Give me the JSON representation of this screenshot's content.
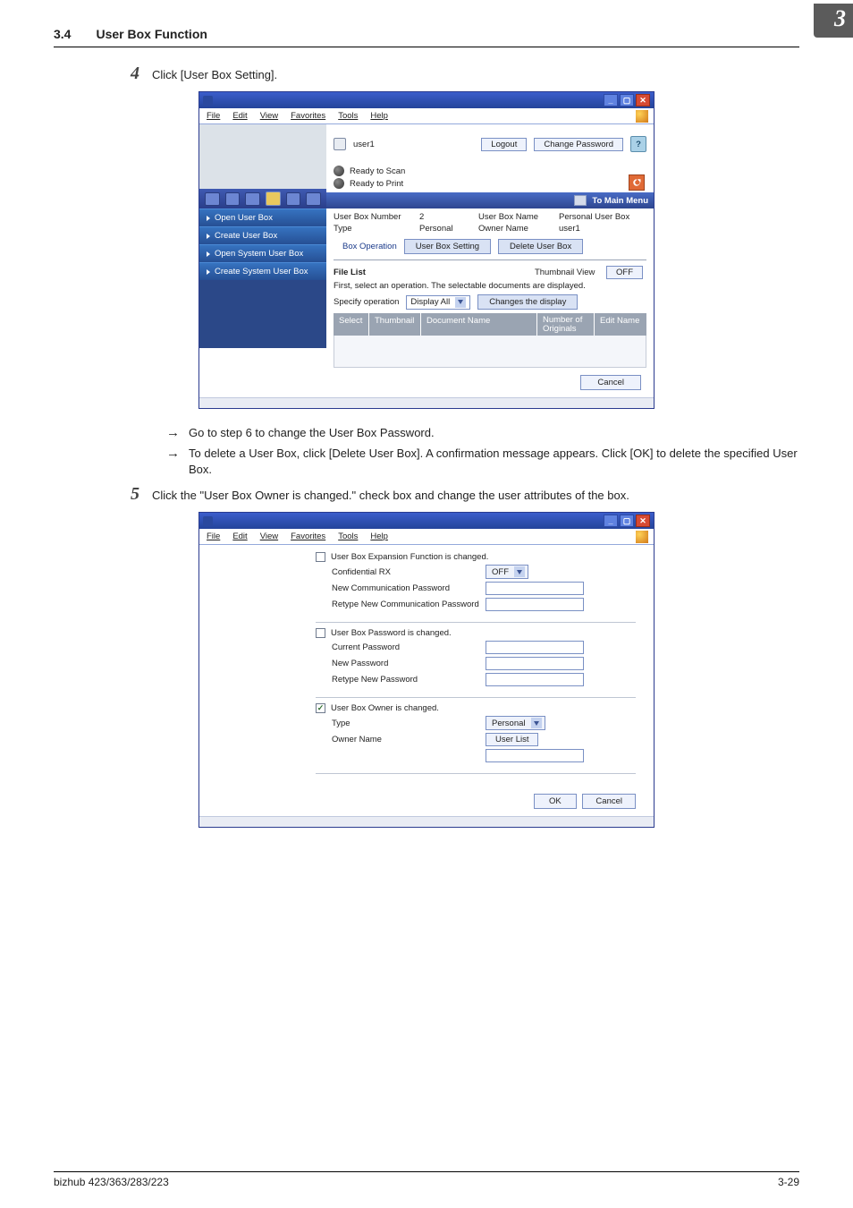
{
  "header": {
    "sec_no": "3.4",
    "title": "User Box Function",
    "chapter": "3"
  },
  "step4": {
    "num": "4",
    "text": "Click [User Box Setting]."
  },
  "shot1": {
    "menubar": [
      "File",
      "Edit",
      "View",
      "Favorites",
      "Tools",
      "Help"
    ],
    "user_label": "user1",
    "logout_btn": "Logout",
    "chpass_btn": "Change Password",
    "status": {
      "scan": "Ready to Scan",
      "print": "Ready to Print"
    },
    "tomain": "To Main Menu",
    "nav": [
      "Open User Box",
      "Create User Box",
      "Open System User Box",
      "Create System User Box"
    ],
    "info": {
      "ubnum_lbl": "User Box Number",
      "ubnum": "2",
      "ubname_lbl": "User Box Name",
      "ubname": "Personal User Box",
      "type_lbl": "Type",
      "type": "Personal",
      "owner_lbl": "Owner Name",
      "owner": "user1"
    },
    "ops": {
      "boxop": "Box Operation",
      "ubset": "User Box Setting",
      "del": "Delete User Box"
    },
    "filelist": {
      "title": "File List",
      "thumb_lbl": "Thumbnail View",
      "thumb_btn": "OFF",
      "note": "First, select an operation. The selectable documents are displayed.",
      "spec_lbl": "Specify operation",
      "spec_val": "Display All",
      "chg_btn": "Changes the display"
    },
    "thead": {
      "sel": "Select",
      "thumb": "Thumbnail",
      "doc": "Document Name",
      "orig": "Number of\nOriginals",
      "edit": "Edit Name"
    },
    "cancel": "Cancel"
  },
  "bullets": {
    "b1": "Go to step 6 to change the User Box Password.",
    "b2": "To delete a User Box, click [Delete User Box]. A confirmation message appears. Click [OK] to delete the specified User Box."
  },
  "step5": {
    "num": "5",
    "text": "Click the \"User Box Owner is changed.\" check box and change the user attributes of the box."
  },
  "shot2": {
    "menubar": [
      "File",
      "Edit",
      "View",
      "Favorites",
      "Tools",
      "Help"
    ],
    "exp_lbl": "User Box Expansion Function is changed.",
    "confrx": "Confidential RX",
    "confrx_val": "OFF",
    "newcomm": "New Communication Password",
    "recomm": "Retype New Communication Password",
    "pwd_lbl": "User Box Password is changed.",
    "curpwd": "Current Password",
    "newpwd": "New Password",
    "repwd": "Retype New Password",
    "own_lbl": "User Box Owner is changed.",
    "type_lbl": "Type",
    "type_val": "Personal",
    "ownname": "Owner Name",
    "userlist": "User List",
    "ok": "OK",
    "cancel": "Cancel"
  },
  "footer": {
    "model": "bizhub 423/363/283/223",
    "page": "3-29"
  }
}
